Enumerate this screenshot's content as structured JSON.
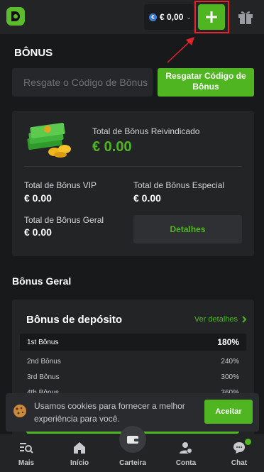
{
  "header": {
    "balance": "€ 0,00",
    "currency_symbol": "€"
  },
  "page": {
    "title": "BÔNUS"
  },
  "code": {
    "placeholder": "Resgate o Código de Bônus",
    "redeem_label_line1": "Resgatar Código de",
    "redeem_label_line2": "Bônus"
  },
  "summary": {
    "total_claimed_label": "Total de Bônus Reivindicado",
    "total_claimed_value": "€ 0.00",
    "vip_label": "Total de Bônus VIP",
    "vip_value": "€ 0.00",
    "special_label": "Total de Bônus Especial",
    "special_value": "€ 0.00",
    "general_label": "Total de Bônus Geral",
    "general_value": "€ 0.00",
    "details_label": "Detalhes"
  },
  "general": {
    "section_title": "Bônus Geral",
    "deposit_title": "Bônus de depósito",
    "see_details": "Ver detalhes",
    "rows": [
      {
        "label": "1st Bônus",
        "pct": "180%"
      },
      {
        "label": "2nd Bônus",
        "pct": "240%"
      },
      {
        "label": "3rd Bônus",
        "pct": "300%"
      },
      {
        "label": "4th Bônus",
        "pct": "360%"
      }
    ]
  },
  "cookie": {
    "text": "Usamos cookies para fornecer a melhor experiência para você.",
    "accept": "Aceitar"
  },
  "nav": {
    "items": [
      {
        "label": "Mais"
      },
      {
        "label": "Início"
      },
      {
        "label": "Carteira"
      },
      {
        "label": "Conta"
      },
      {
        "label": "Chat"
      }
    ]
  },
  "colors": {
    "accent": "#4fb621",
    "background": "#18191b",
    "card": "#232426",
    "annotation": "#e3232d"
  }
}
